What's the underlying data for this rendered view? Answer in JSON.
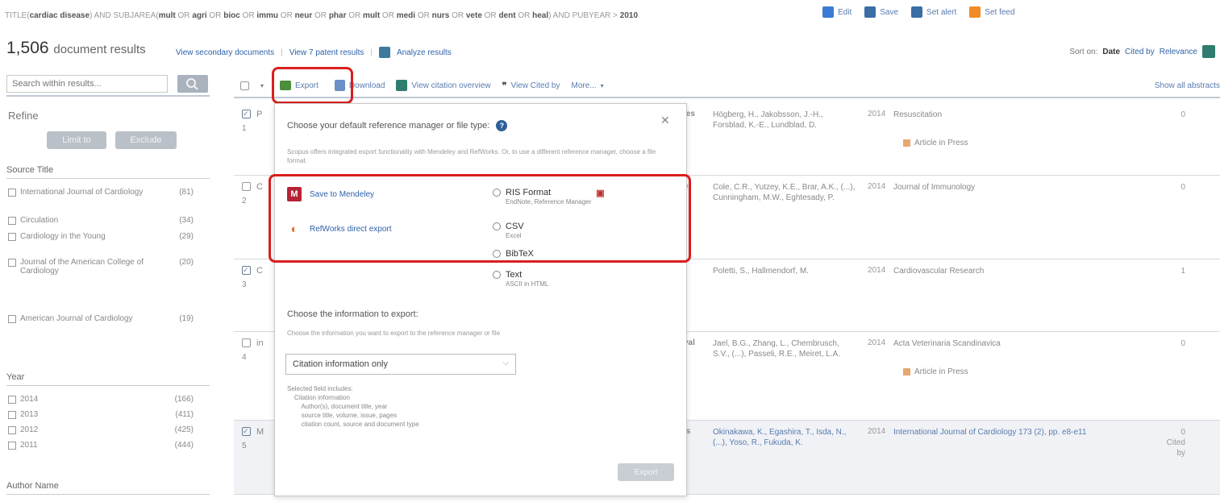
{
  "query": {
    "parts": [
      {
        "text": "TITLE(",
        "bold": false
      },
      {
        "text": "cardiac disease",
        "bold": true
      },
      {
        "text": ") AND SUBJAREA(",
        "bold": false
      },
      {
        "text": "mult",
        "bold": true
      },
      {
        "text": " OR ",
        "bold": false
      },
      {
        "text": "agri",
        "bold": true
      },
      {
        "text": " OR ",
        "bold": false
      },
      {
        "text": "bioc",
        "bold": true
      },
      {
        "text": " OR ",
        "bold": false
      },
      {
        "text": "immu",
        "bold": true
      },
      {
        "text": " OR ",
        "bold": false
      },
      {
        "text": "neur",
        "bold": true
      },
      {
        "text": " OR ",
        "bold": false
      },
      {
        "text": "phar",
        "bold": true
      },
      {
        "text": " OR ",
        "bold": false
      },
      {
        "text": "mult",
        "bold": true
      },
      {
        "text": " OR ",
        "bold": false
      },
      {
        "text": "medi",
        "bold": true
      },
      {
        "text": " OR ",
        "bold": false
      },
      {
        "text": "nurs",
        "bold": true
      },
      {
        "text": " OR ",
        "bold": false
      },
      {
        "text": "vete",
        "bold": true
      },
      {
        "text": " OR ",
        "bold": false
      },
      {
        "text": "dent",
        "bold": true
      },
      {
        "text": " OR ",
        "bold": false
      },
      {
        "text": "heal",
        "bold": true
      },
      {
        "text": ") AND PUBYEAR > ",
        "bold": false
      },
      {
        "text": "2010",
        "bold": true
      }
    ],
    "actions": [
      {
        "label": "Edit",
        "icon": "edit-icon",
        "color": "#3a7bd5"
      },
      {
        "label": "Save",
        "icon": "save-icon",
        "color": "#3a6ea5"
      },
      {
        "label": "Set alert",
        "icon": "alert-icon",
        "color": "#3a6ea5"
      },
      {
        "label": "Set feed",
        "icon": "rss-icon",
        "color": "#f08a24"
      }
    ]
  },
  "results_header": {
    "count": "1,506",
    "label": "document results",
    "links": [
      "View secondary documents",
      "View 7 patent results",
      "Analyze results"
    ],
    "sort_label": "Sort on:",
    "sort_options": [
      "Date",
      "Cited by",
      "Relevance"
    ]
  },
  "search": {
    "placeholder": "Search within results..."
  },
  "toolbar": {
    "export": "Export",
    "download": "Download",
    "citation_overview": "View citation overview",
    "cited_by": "View Cited by",
    "more": "More...",
    "show_abstracts": "Show all abstracts"
  },
  "sidebar": {
    "refine": "Refine",
    "limit_to": "Limit to",
    "exclude": "Exclude",
    "source_title": {
      "heading": "Source Title",
      "items": [
        {
          "name": "International Journal of Cardiology",
          "count": "(81)"
        },
        {
          "name": "Circulation",
          "count": "(34)"
        },
        {
          "name": "Cardiology in the Young",
          "count": "(29)"
        },
        {
          "name": "Journal of the American College of Cardiology",
          "count": "(20)"
        },
        {
          "name": "American Journal of Cardiology",
          "count": "(19)"
        }
      ]
    },
    "year": {
      "heading": "Year",
      "items": [
        {
          "name": "2014",
          "count": "(166)"
        },
        {
          "name": "2013",
          "count": "(411)"
        },
        {
          "name": "2012",
          "count": "(425)"
        },
        {
          "name": "2011",
          "count": "(444)"
        }
      ]
    },
    "author_heading": "Author Name"
  },
  "results": [
    {
      "num": "1",
      "frag": "P",
      "tail": "ies",
      "authors": "Högberg, H., Jakobsson, J.-H., Forsblad, K.-E., Lundblad, D.",
      "authors_link": false,
      "year": "2014",
      "source": "Resuscitation",
      "source_link": false,
      "cited": "0",
      "badge": "Article in Press",
      "checked": true
    },
    {
      "num": "2",
      "frag": "C",
      "tail": "e",
      "authors": "Cole, C.R., Yutzey, K.E., Brar, A.K., (...), Cunningham, M.W., Eghtesady, P.",
      "authors_link": false,
      "year": "2014",
      "source": "Journal of Immunology",
      "source_link": false,
      "cited": "0",
      "badge": "",
      "checked": false
    },
    {
      "num": "3",
      "frag": "C",
      "tail": "",
      "authors": "Poletti, S., Hallmendorf, M.",
      "authors_link": false,
      "year": "2014",
      "source": "Cardiovascular Research",
      "source_link": false,
      "cited": "1",
      "badge": "",
      "checked": true
    },
    {
      "num": "4",
      "frag": "in",
      "tail": "val",
      "authors": "Jael, B.G., Zhang, L., Chembrusch, S.V., (...), Passeli, R.E., Meiret, L.A.",
      "authors_link": false,
      "year": "2014",
      "source": "Acta Veterinaria Scandinavica",
      "source_link": false,
      "cited": "0",
      "badge": "Article in Press",
      "checked": false
    },
    {
      "num": "5",
      "frag": "M",
      "tail": "is",
      "authors": "Okinakawa, K., Egashira, T., Isda, N., (...), Yoso, R., Fukuda, K.",
      "authors_link": true,
      "year": "2014",
      "source": "International Journal of Cardiology 173 (2), pp. e8-e11",
      "source_link": true,
      "cited": "0 Cited by",
      "badge": "",
      "checked": true
    }
  ],
  "export_popup": {
    "title": "Choose your default reference manager or file type:",
    "description": "Scopus offers integrated export functionality with Mendeley and RefWorks. Or, to use a different reference manager, choose a file format.",
    "managers": [
      {
        "label": "Save to Mendeley",
        "icon": "mendeley-icon",
        "color": "#b52334",
        "glyph": "M"
      },
      {
        "label": "RefWorks direct export",
        "icon": "refworks-icon",
        "color": "#e8742a",
        "glyph": "◐"
      }
    ],
    "formats": [
      {
        "label": "RIS Format",
        "sub": "EndNote, Reference Manager"
      },
      {
        "label": "CSV",
        "sub": "Excel"
      },
      {
        "label": "BibTeX",
        "sub": ""
      },
      {
        "label": "Text",
        "sub": "ASCII in HTML"
      }
    ],
    "info_heading": "Choose the information to export:",
    "info_description": "Choose the information you want to export to the reference manager or file",
    "select_value": "Citation information only",
    "fields": "Selected field includes:\n    Citation information\n        Author(s), document title, year\n        source title, volume, issue, pages\n        citation count, source and document type",
    "submit": "Export"
  }
}
